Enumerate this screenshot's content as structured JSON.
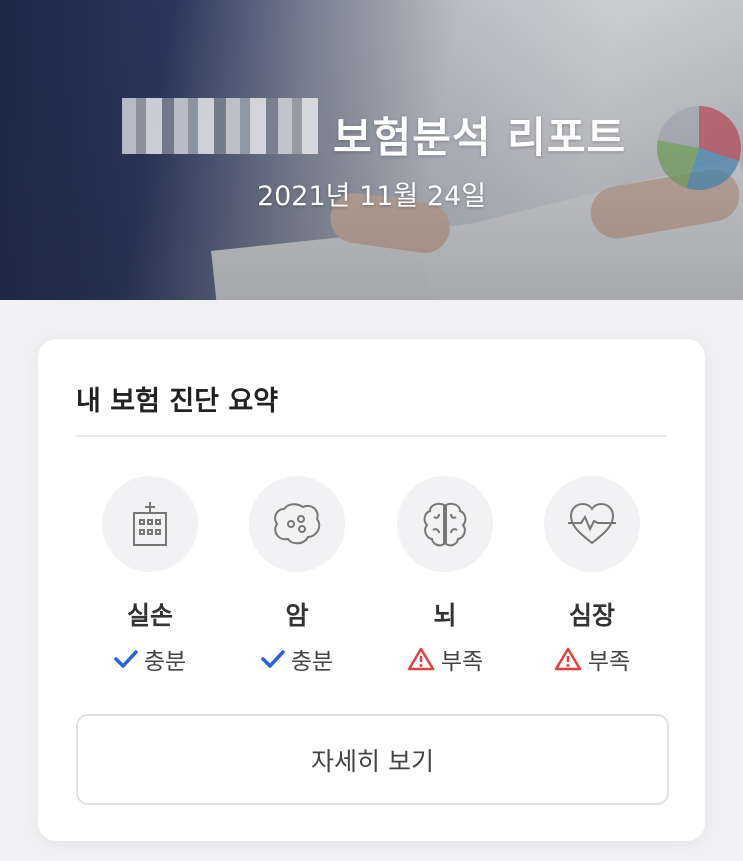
{
  "hero": {
    "title": "보험분석 리포트",
    "date": "2021년 11월 24일"
  },
  "summary": {
    "title": "내 보험 진단 요약",
    "items": [
      {
        "icon": "hospital-icon",
        "label": "실손",
        "status": "충분",
        "status_icon": "check-icon",
        "status_color": "#2f5fe0"
      },
      {
        "icon": "cancer-cell-icon",
        "label": "암",
        "status": "충분",
        "status_icon": "check-icon",
        "status_color": "#2f5fe0"
      },
      {
        "icon": "brain-icon",
        "label": "뇌",
        "status": "부족",
        "status_icon": "warning-icon",
        "status_color": "#e24040"
      },
      {
        "icon": "heart-pulse-icon",
        "label": "심장",
        "status": "부족",
        "status_icon": "warning-icon",
        "status_color": "#e24040"
      }
    ],
    "detail_button": "자세히 보기"
  }
}
